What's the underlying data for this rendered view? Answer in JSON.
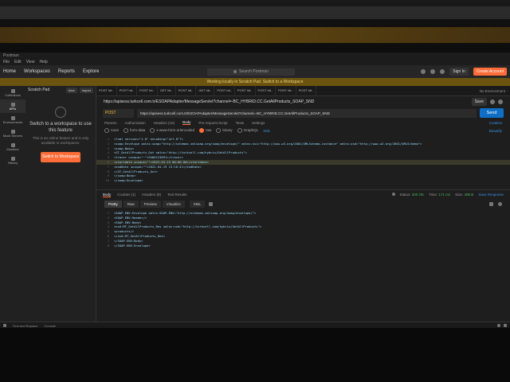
{
  "app": {
    "title": "Postman",
    "menu": [
      "File",
      "Edit",
      "View",
      "Help"
    ]
  },
  "header": {
    "nav": [
      "Home",
      "Workspaces",
      "Reports",
      "Explore"
    ],
    "search_placeholder": "Search Postman",
    "signin": "Sign In",
    "create_account": "Create Account"
  },
  "warning": "Working locally in Scratch Pad. Switch to a Workspace",
  "sidebar": {
    "items": [
      "Collections",
      "APIs",
      "Environments",
      "Mock Servers",
      "Monitors",
      "History"
    ]
  },
  "panel": {
    "title": "Scratch Pad",
    "new_label": "New",
    "import_label": "Import",
    "heading": "Switch to a workspace to use this feature",
    "desc": "This is an online feature and is only available in workspaces.",
    "button": "Switch to Workspace"
  },
  "tabs": [
    "POST htt..",
    "POST htt..",
    "POST htt..",
    "GET htt..",
    "POST htt..",
    "GET htt..",
    "POST htt..",
    "POST htt..",
    "POST htt..",
    "POST htt..",
    "POST htt..",
    "POST htt..",
    "POST htt.."
  ],
  "environment": "No Environment",
  "request": {
    "title": "https://apisess.turkcell.com.tr/ESOAPAdapter/MessageServlet?channel=-BC_HYBRID.CC.GetAllProducts_SOAP_SND",
    "save": "Save",
    "method": "POST",
    "url": "https://apisess.turkcell.com.tr/ESOAPAdapter/MessageServlet?channel=-BC_HYBRID.CC.GetAllProducts_SOAP_SND",
    "send": "Send",
    "subtabs": [
      "Params",
      "Authorization",
      "Headers (10)",
      "Body",
      "Pre-request Script",
      "Tests",
      "Settings"
    ],
    "cookies": "Cookies",
    "body_types": [
      "none",
      "form-data",
      "x-www-form-urlencoded",
      "raw",
      "binary",
      "GraphQL",
      "XML"
    ],
    "beautify": "Beautify",
    "body_lines": [
      "<?xml version=\"1.0\" encoding=\"utf-8\"?>",
      "<soap:Envelope xmlns:soap=\"http://schemas.xmlsoap.org/soap/envelope/\" xmlns:xsi=\"http://www.w3.org/2001/XMLSchema-instance\" xmlns:xsd=\"http://www.w3.org/2001/XMLSchema\">",
      "    <soap:Body>",
      "        <GT_GetAllProducts_Out xmlns=\"http://turkcell.com/hybris/GetAllProducts\">",
      "            <tracer unique=\"~\">9466123891</tracer>",
      "            <startdate unique=\"\">2022-03-23 00:00:00</startdate>",
      "            <endDate unique=\"\">2022-04-19 13:16:41</endDate>",
      "        </GT_GetAllProducts_Out>",
      "    </soap:Body>",
      "</soap:Envelope>"
    ]
  },
  "response": {
    "tabs": [
      "Body",
      "Cookies (1)",
      "Headers (9)",
      "Test Results"
    ],
    "status_label": "Status:",
    "status_value": "200 OK",
    "time_label": "Time:",
    "time_value": "171 ms",
    "size_label": "Size:",
    "size_value": "408 B",
    "save_response": "Save Response",
    "views": [
      "Pretty",
      "Raw",
      "Preview",
      "Visualize"
    ],
    "format": "XML",
    "lines": [
      "<SOAP-ENV:Envelope xmlns:SOAP-ENV=\"http://schemas.xmlsoap.org/soap/envelope/\">",
      "    <SOAP-ENV:Header/>",
      "    <SOAP-ENV:Body>",
      "        <ns0:MT_GetAllProducts_Res xmlns:ns0=\"http://turkcell.com/hybris/GetAllProducts\">",
      "            <products/>",
      "        </ns0:MT_GetAllProducts_Res>",
      "    </SOAP-ENV:Body>",
      "</SOAP-ENV:Envelope>"
    ]
  },
  "statusbar": {
    "find_replace": "Find and Replace",
    "console": "Console"
  }
}
